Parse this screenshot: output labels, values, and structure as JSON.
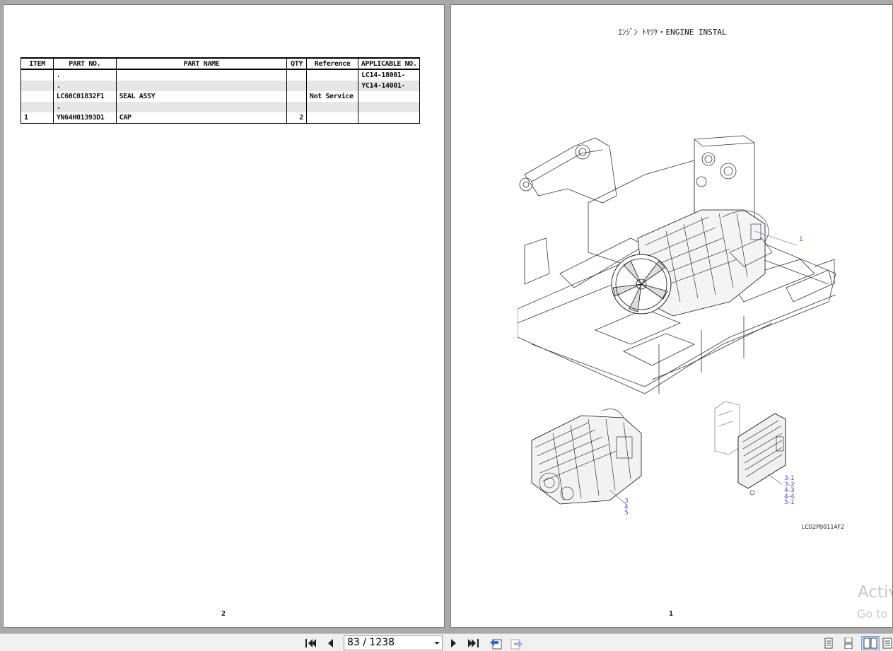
{
  "left_page": {
    "table": {
      "headers": {
        "item": "ITEM",
        "part_no": "PART NO.",
        "part_name": "PART NAME",
        "qty": "QTY",
        "reference": "Reference",
        "applicable_no": "APPLICABLE NO."
      },
      "rows": [
        {
          "item": "",
          "part_no": ".",
          "part_name": "",
          "qty": "",
          "reference": "",
          "applicable_no": "LC14-18001-"
        },
        {
          "item": "",
          "part_no": ".",
          "part_name": "",
          "qty": "",
          "reference": "",
          "applicable_no": "YC14-14001-"
        },
        {
          "item": "",
          "part_no": "LC60C01832F1",
          "part_name": "SEAL ASSY",
          "qty": "",
          "reference": "Not Service",
          "applicable_no": ""
        },
        {
          "item": "",
          "part_no": ".",
          "part_name": "",
          "qty": "",
          "reference": "",
          "applicable_no": ""
        },
        {
          "item": "1",
          "part_no": "YN64H01393D1",
          "part_name": "CAP",
          "qty": "2",
          "reference": "",
          "applicable_no": ""
        }
      ]
    },
    "page_number": "2"
  },
  "right_page": {
    "title": "ｴﾝｼﾞﾝ ﾄﾘﾂｹ・ENGINE INSTAL",
    "callouts": {
      "main": "1",
      "engine": [
        "3",
        "4",
        "5"
      ],
      "ecu": [
        "3-1",
        "3-2",
        "4-3",
        "4-4",
        "5-1"
      ]
    },
    "drawing_code": "LC02P00114F2",
    "page_number": "1"
  },
  "watermark": {
    "line1": "Activ",
    "line2": "Go to"
  },
  "toolbar": {
    "page_indicator": "83 / 1238",
    "icons": {
      "first": "first-page-icon",
      "prev": "previous-page-icon",
      "next": "next-page-icon",
      "last": "last-page-icon",
      "back": "go-back-icon",
      "forward": "go-forward-icon"
    }
  }
}
